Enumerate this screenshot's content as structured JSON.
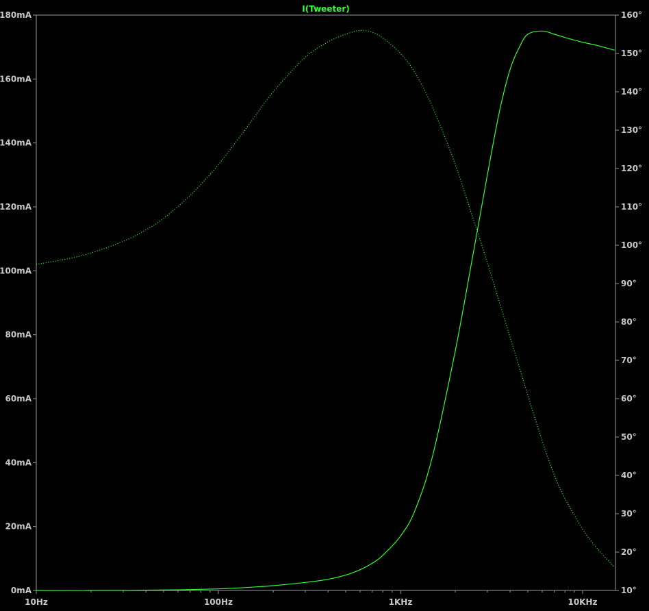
{
  "chart_data": {
    "type": "line",
    "title": "I(Tweeter)",
    "x_axis": {
      "scale": "log",
      "range_hz": [
        10,
        15000
      ],
      "tick_labels": [
        "10Hz",
        "100Hz",
        "1KHz",
        "10KHz"
      ]
    },
    "y_left": {
      "unit": "mA",
      "range": [
        0,
        180
      ],
      "tick_labels": [
        "0mA",
        "20mA",
        "40mA",
        "60mA",
        "80mA",
        "100mA",
        "120mA",
        "140mA",
        "160mA",
        "180mA"
      ]
    },
    "y_right": {
      "unit": "°",
      "range": [
        10,
        160
      ],
      "tick_labels": [
        "10°",
        "20°",
        "30°",
        "40°",
        "50°",
        "60°",
        "70°",
        "80°",
        "90°",
        "100°",
        "110°",
        "120°",
        "130°",
        "140°",
        "150°",
        "160°"
      ]
    },
    "grid": false,
    "series": [
      {
        "style": "solid",
        "axis": "left",
        "x_hz": [
          10,
          30,
          60,
          100,
          150,
          200,
          300,
          400,
          500,
          600,
          700,
          800,
          1000,
          1200,
          1500,
          2000,
          2500,
          3000,
          3500,
          4000,
          4500,
          5000,
          6000,
          7000,
          8000,
          10000,
          12000,
          15000
        ],
        "values": [
          0,
          0.05,
          0.2,
          0.5,
          1,
          1.5,
          2.5,
          3.5,
          4.8,
          6.5,
          8.5,
          11,
          17,
          25,
          42,
          75,
          105,
          130,
          150,
          163,
          170,
          174,
          175,
          174,
          173,
          171.5,
          170.5,
          169
        ]
      },
      {
        "style": "dotted",
        "axis": "right",
        "x_hz": [
          10,
          15,
          20,
          30,
          40,
          50,
          70,
          100,
          150,
          200,
          300,
          400,
          500,
          600,
          700,
          800,
          1000,
          1200,
          1500,
          2000,
          2500,
          3000,
          3500,
          4000,
          5000,
          6000,
          7000,
          8000,
          10000,
          12000,
          15000
        ],
        "values": [
          95,
          96.5,
          98,
          101,
          104,
          107,
          113,
          121,
          132,
          140,
          149,
          153,
          155,
          156,
          155.5,
          154,
          150,
          145,
          136,
          121,
          107,
          95.5,
          85,
          76,
          61,
          49,
          40,
          34,
          26,
          21,
          16
        ]
      }
    ],
    "colors": {
      "trace": "#33ff33",
      "text": "#c8c8c8",
      "axis": "#9a9a9a",
      "background": "#000000"
    }
  }
}
